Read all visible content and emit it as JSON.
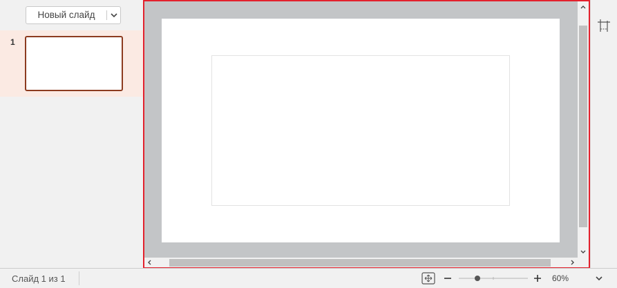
{
  "left_panel": {
    "new_slide_label": "Новый слайд",
    "slides": [
      {
        "number": "1"
      }
    ]
  },
  "icons": {
    "new_slide_dropdown": "chevron-down-icon",
    "slide_settings": "slide-size-icon",
    "fit_to_slide": "fit-slide-icon",
    "zoom_out": "minus-icon",
    "zoom_in": "plus-icon",
    "zoom_dropdown": "chevron-down-icon"
  },
  "statusbar": {
    "slide_counter": "Слайд 1 из 1",
    "zoom_value": "60%",
    "zoom_level": 0.6
  },
  "colors": {
    "selected_slide_border": "#8c3b1f",
    "selected_slide_row": "#fbeae3",
    "editor_highlight_border": "#e3202c",
    "canvas_background": "#c3c5c7"
  }
}
